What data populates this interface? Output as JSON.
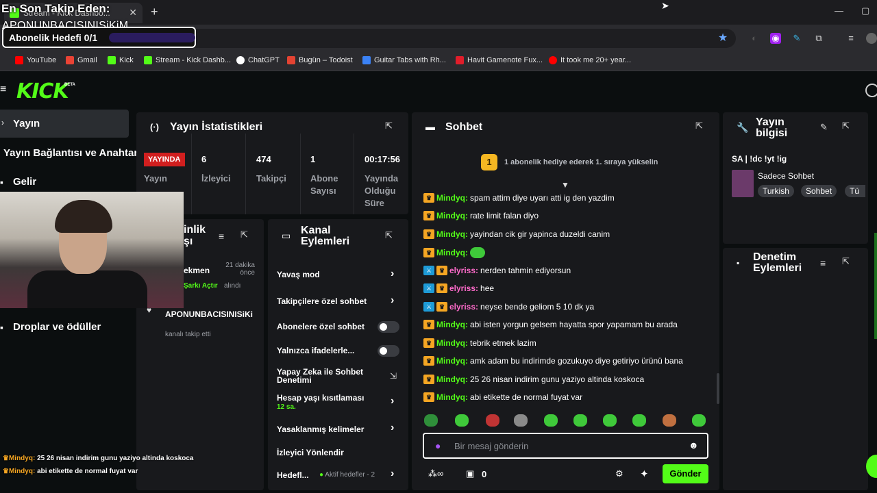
{
  "browser": {
    "tab_title": "Stream - Kick Dashbo...",
    "new_tab": "+",
    "window_controls": [
      "—",
      "▢"
    ],
    "bookmarks": [
      {
        "label": "YouTube",
        "color": "#ff0000"
      },
      {
        "label": "Gmail",
        "color": "#ea4335"
      },
      {
        "label": "Kick",
        "color": "#53fc18"
      },
      {
        "label": "Stream - Kick Dashb...",
        "color": "#53fc18"
      },
      {
        "label": "ChatGPT",
        "color": "#ffffff"
      },
      {
        "label": "Bugün – Todoist",
        "color": "#e44332"
      },
      {
        "label": "Guitar Tabs with Rh...",
        "color": "#3b82f6"
      },
      {
        "label": "Havit Gamenote Fux...",
        "color": "#e11d2a"
      },
      {
        "label": "It took me 20+ year...",
        "color": "#ff0000"
      }
    ]
  },
  "overlay": {
    "latest_follower_label": "En Son Takip Eden:",
    "latest_follower_name": "APONUNBACISINISiKiM",
    "sub_goal": "Abonelik Hedefi 0/1",
    "chat_lines": [
      {
        "user": "Mindyq:",
        "text": "25 26 nisan indirim gunu yaziyo altinda koskoca"
      },
      {
        "user": "Mindyq:",
        "text": "abi etikette de normal fuyat var"
      }
    ]
  },
  "kick": {
    "logo": "KICK",
    "beta": "BETA"
  },
  "sidebar": {
    "items": [
      {
        "label": "Yayın"
      },
      {
        "label": "Yayın Bağlantısı ve Anahtarı"
      },
      {
        "label": "Gelir"
      },
      {
        "label": "Droplar ve ödüller"
      }
    ]
  },
  "stats": {
    "title": "Yayın İstatistikleri",
    "live_badge": "YAYINDA",
    "live_label": "Yayın",
    "cells": [
      {
        "value": "6",
        "label": "İzleyici"
      },
      {
        "value": "474",
        "label": "Takipçi"
      },
      {
        "value": "1",
        "label": "Abone Sayısı"
      },
      {
        "value": "00:17:56",
        "label": "Yayında Olduğu Süre"
      }
    ]
  },
  "activity": {
    "title_part": "inlik",
    "title_part2": "şı",
    "item1_name": "ekmen",
    "item1_time": "21 dakika önce",
    "item1_reward": "Şarkı Açtır",
    "item1_suffix": "alındı",
    "item2_name": "APONUNBACISINISiKi",
    "item2_desc": "kanalı takip etti"
  },
  "actions": {
    "title": "Kanal Eylemleri",
    "items": [
      {
        "label": "Yavaş mod"
      },
      {
        "label": "Takipçilere özel sohbet"
      },
      {
        "label": "Abonelere özel sohbet"
      },
      {
        "label": "Yalnızca ifadelerle..."
      },
      {
        "label": "Yapay Zeka ile Sohbet Denetimi"
      },
      {
        "label": "Hesap yaşı kısıtlaması",
        "sub": "12 sa."
      },
      {
        "label": "Yasaklanmış kelimeler"
      },
      {
        "label": "İzleyici Yönlendir"
      },
      {
        "label": "Hedefl...",
        "sub": "Aktif hedefler - 2"
      }
    ]
  },
  "chat": {
    "title": "Sohbet",
    "pinned_rank": "1",
    "pinned_text": "1 abonelik hediye ederek 1. sıraya yükselin",
    "messages": [
      {
        "user": "Mindyq:",
        "text": "spam attim diye uyarı atti ig den yazdim",
        "mod": false,
        "color": "g"
      },
      {
        "user": "Mindyq:",
        "text": "rate limit falan diyo",
        "mod": false,
        "color": "g"
      },
      {
        "user": "Mindyq:",
        "text": "yayindan cik gir yapinca duzeldi canim",
        "mod": false,
        "color": "g"
      },
      {
        "user": "Mindyq:",
        "text": "",
        "mod": false,
        "color": "g",
        "emote": true
      },
      {
        "user": "elyriss:",
        "text": "nerden tahmin ediyorsun",
        "mod": true,
        "color": "p"
      },
      {
        "user": "elyriss:",
        "text": "hee",
        "mod": true,
        "color": "p"
      },
      {
        "user": "elyriss:",
        "text": "neyse bende geliom 5 10 dk ya",
        "mod": true,
        "color": "p"
      },
      {
        "user": "Mindyq:",
        "text": "abi isten yorgun gelsem hayatta spor yapamam bu arada",
        "mod": false,
        "color": "g"
      },
      {
        "user": "Mindyq:",
        "text": "tebrik etmek lazim",
        "mod": false,
        "color": "g"
      },
      {
        "user": "Mindyq:",
        "text": "amk adam bu indirimde gozukuyo diye getiriyo ürünü bana",
        "mod": false,
        "color": "g"
      },
      {
        "user": "Mindyq:",
        "text": "25 26 nisan indirim gunu yaziyo altinda koskoca",
        "mod": false,
        "color": "g"
      },
      {
        "user": "Mindyq:",
        "text": "abi etikette de normal fuyat var",
        "mod": false,
        "color": "g"
      }
    ],
    "input_placeholder": "Bir mesaj gönderin",
    "points": "0",
    "send_label": "Gönder"
  },
  "info": {
    "title": "Yayın bilgisi",
    "stream_title": "SA | !dc !yt !ig",
    "category": "Sadece Sohbet",
    "tags": [
      "Turkish",
      "Sohbet",
      "Tü"
    ]
  },
  "moderation": {
    "title": "Denetim Eylemleri"
  }
}
